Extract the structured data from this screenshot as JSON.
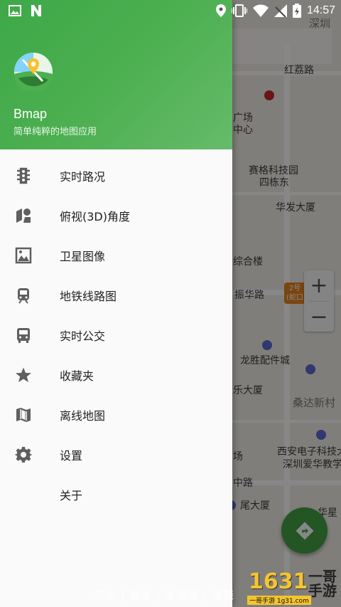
{
  "status_bar": {
    "time": "14:57",
    "left_icons": [
      "image-icon",
      "n-notification-icon"
    ],
    "right_icons": [
      "location-icon",
      "vibrate-icon",
      "wifi-icon",
      "signal-no-service-icon",
      "battery-charging-icon"
    ]
  },
  "drawer": {
    "app_name": "Bmap",
    "tagline": "简单纯粹的地图应用",
    "header_color": "#4caf50",
    "items": [
      {
        "label": "实时路况",
        "icon": "traffic-light-icon"
      },
      {
        "label": "俯视(3D)角度",
        "icon": "3d-view-icon"
      },
      {
        "label": "卫星图像",
        "icon": "satellite-image-icon"
      },
      {
        "label": "地铁线路图",
        "icon": "subway-icon"
      },
      {
        "label": "实时公交",
        "icon": "bus-icon"
      },
      {
        "label": "收藏夹",
        "icon": "star-icon"
      },
      {
        "label": "离线地图",
        "icon": "offline-map-icon"
      },
      {
        "label": "设置",
        "icon": "gear-icon"
      },
      {
        "label": "关于",
        "icon": ""
      }
    ]
  },
  "map": {
    "labels": [
      "深圳",
      "红荔路",
      "广场",
      "中心",
      "赛格科技园",
      "四栋东",
      "华发大厦",
      "综合楼",
      "振华路",
      "龙胜配件城",
      "乐大厦",
      "桑达新村",
      "场",
      "西安电子科技大",
      "深圳爱华教学",
      "中路",
      "尾大厦",
      "华星"
    ],
    "metro_badge": [
      "2号",
      "(蛇口"
    ],
    "zoom_in": "+",
    "zoom_out": "−",
    "accent_color": "#43a047"
  },
  "watermark": {
    "text": "添加 | 管友 | 游戏圈 | 资源",
    "logo_number": "1631",
    "logo_brand_line1": "一哥",
    "logo_brand_line2": "手游",
    "logo_site": "一哥手游 1g31.com"
  }
}
